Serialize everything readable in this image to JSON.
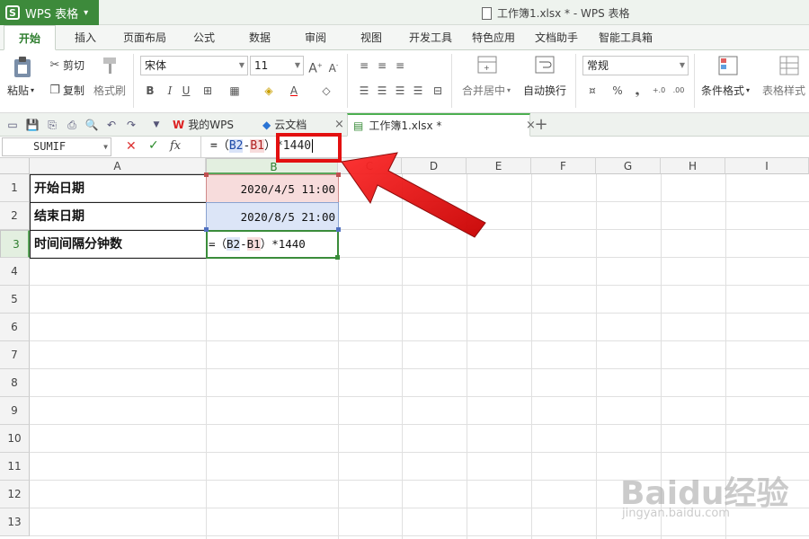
{
  "app": {
    "name": "WPS 表格",
    "logo_letter": "S"
  },
  "title": {
    "text": "工作簿1.xlsx * - WPS 表格"
  },
  "ribbon_tabs": [
    "开始",
    "插入",
    "页面布局",
    "公式",
    "数据",
    "审阅",
    "视图",
    "开发工具",
    "特色应用",
    "文档助手",
    "智能工具箱"
  ],
  "toolbar": {
    "paste": "粘贴",
    "cut": "剪切",
    "copy": "复制",
    "format_painter": "格式刷",
    "font_name": "宋体",
    "font_size": "11",
    "bold": "B",
    "italic": "I",
    "underline": "U",
    "merge_center": "合并居中",
    "wrap_text": "自动换行",
    "number_format": "常规",
    "percent": "%",
    "comma": "❟",
    "conditional_format": "条件格式",
    "table_style": "表格样式"
  },
  "doc_tabs": [
    {
      "label": "我的WPS"
    },
    {
      "label": "云文档"
    },
    {
      "label": "工作簿1.xlsx *"
    }
  ],
  "formula_bar": {
    "name_box": "SUMIF",
    "cancel": "✕",
    "confirm": "✓",
    "fx": "fx",
    "formula_prefix": "=（",
    "ref1": "B2",
    "minus": "-",
    "ref2": "B1",
    "formula_suffix": "）*1440"
  },
  "columns": [
    "A",
    "B",
    "C",
    "D",
    "E",
    "F",
    "G",
    "H",
    "I"
  ],
  "rows": [
    "1",
    "2",
    "3",
    "4",
    "5",
    "6",
    "7",
    "8",
    "9",
    "10",
    "11",
    "12",
    "13"
  ],
  "cells": {
    "A1": "开始日期",
    "A2": "结束日期",
    "A3": "时间间隔分钟数",
    "B1": "2020/4/5 11:00",
    "B2": "2020/8/5 21:00",
    "B3_prefix": "=（",
    "B3_ref1": "B2",
    "B3_minus": "-",
    "B3_ref2": "B1",
    "B3_suffix": "）*1440"
  },
  "watermark": {
    "brand": "Baidu经验",
    "url": "jingyan.baidu.com"
  },
  "colors": {
    "accent": "#3d8a3b",
    "annotation_red": "#e31010"
  }
}
